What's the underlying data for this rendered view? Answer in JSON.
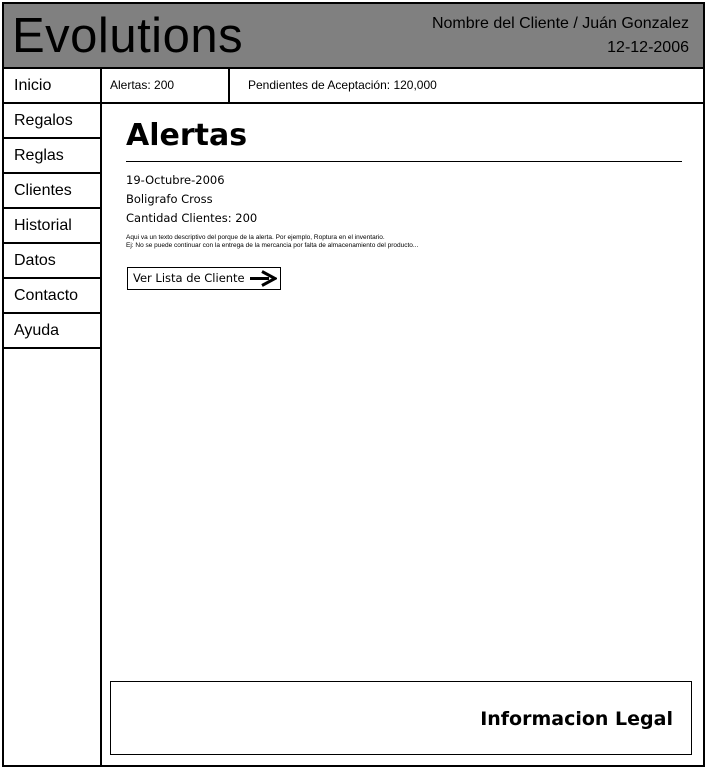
{
  "app": {
    "logo": "Evolutions",
    "client": "Nombre del Cliente / Juán Gonzalez",
    "date": "12-12-2006"
  },
  "sidebar": {
    "items": [
      {
        "label": "Inicio"
      },
      {
        "label": "Regalos"
      },
      {
        "label": "Reglas"
      },
      {
        "label": "Clientes"
      },
      {
        "label": "Historial"
      },
      {
        "label": "Datos"
      },
      {
        "label": "Contacto"
      },
      {
        "label": "Ayuda"
      }
    ]
  },
  "status": {
    "alerts": "Alertas: 200",
    "pending": "Pendientes de Aceptación: 120,000"
  },
  "main": {
    "title": "Alertas",
    "date": "19-Octubre-2006",
    "product": "Boligrafo Cross",
    "clients": "Cantidad Clientes: 200",
    "desc_line1": "Aqui va un texto descriptivo del porque de la alerta. Por ejemplo, Roptura en el inventario.",
    "desc_line2": "Ej: No se puede continuar con la entrega de la mercancia por falta de almacenamiento del producto...",
    "button_label": "Ver Lista de Cliente",
    "button_icon": "arrow-right-icon"
  },
  "footer": {
    "legal": "Informacion Legal"
  }
}
